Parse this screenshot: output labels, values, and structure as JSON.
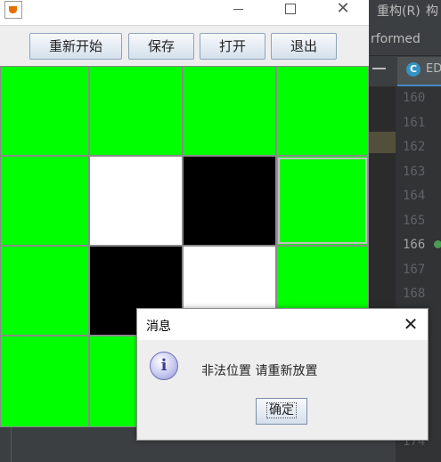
{
  "ide": {
    "menu_item": "重构(R)",
    "menu_item_next": "构",
    "performed_text": "rformed",
    "tab_label": "ED",
    "tab_icon": "C",
    "line_numbers": [
      "160",
      "161",
      "162",
      "163",
      "164",
      "165",
      "166",
      "167",
      "168",
      "174"
    ],
    "current_line": "166"
  },
  "window": {
    "controls": {
      "minimize": "minimize",
      "maximize": "maximize",
      "close": "close"
    }
  },
  "toolbar": {
    "restart_label": "重新开始",
    "save_label": "保存",
    "open_label": "打开",
    "exit_label": "退出"
  },
  "board": {
    "rows": 4,
    "cols": 4,
    "cells": [
      [
        "green",
        "green",
        "green",
        "green"
      ],
      [
        "green",
        "white",
        "black",
        "green"
      ],
      [
        "green",
        "black",
        "white",
        "green"
      ],
      [
        "green",
        "green",
        "green",
        "green"
      ]
    ],
    "selected_cell": [
      1,
      3
    ],
    "colors": {
      "empty": "#00ff00",
      "white": "#ffffff",
      "black": "#000000"
    }
  },
  "dialog": {
    "title": "消息",
    "icon": "info-icon",
    "message": "非法位置 请重新放置",
    "ok_label": "确定"
  }
}
